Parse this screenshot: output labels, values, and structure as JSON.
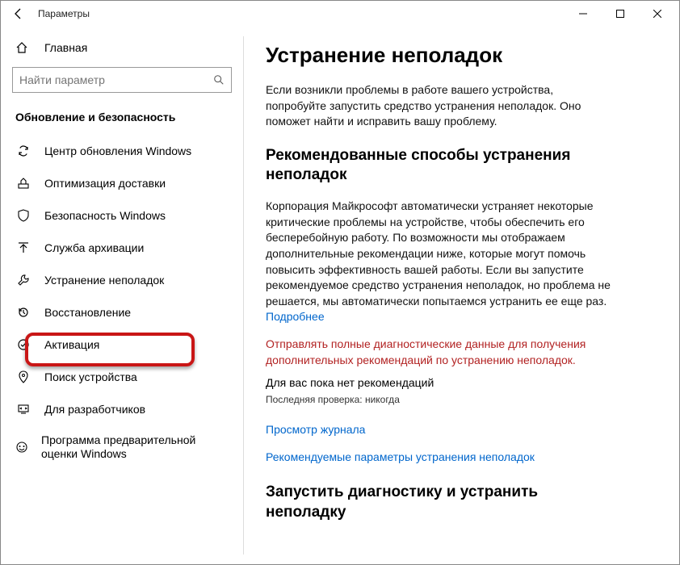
{
  "window": {
    "title": "Параметры"
  },
  "sidebar": {
    "home": "Главная",
    "search_placeholder": "Найти параметр",
    "section": "Обновление и безопасность",
    "items": [
      {
        "label": "Центр обновления Windows"
      },
      {
        "label": "Оптимизация доставки"
      },
      {
        "label": "Безопасность Windows"
      },
      {
        "label": "Служба архивации"
      },
      {
        "label": "Устранение неполадок"
      },
      {
        "label": "Восстановление"
      },
      {
        "label": "Активация"
      },
      {
        "label": "Поиск устройства"
      },
      {
        "label": "Для разработчиков"
      },
      {
        "label": "Программа предварительной оценки Windows"
      }
    ]
  },
  "main": {
    "h1": "Устранение неполадок",
    "intro": "Если возникли проблемы в работе вашего устройства, попробуйте запустить средство устранения неполадок. Оно поможет найти и исправить вашу проблему.",
    "h2a": "Рекомендованные способы устранения неполадок",
    "p2": "Корпорация Майкрософт автоматически устраняет некоторые критические проблемы на устройстве, чтобы обеспечить его бесперебойную работу. По возможности мы отображаем дополнительные рекомендации ниже, которые могут помочь повысить эффективность вашей работы. Если вы запустите рекомендуемое средство устранения неполадок, но проблема не решается, мы автоматически попытаемся устранить ее еще раз. ",
    "learn_more": "Подробнее",
    "red": "Отправлять полные диагностические данные для получения дополнительных рекомендаций по устранению неполадок.",
    "no_rec": "Для вас пока нет рекомендаций",
    "last_check": "Последняя проверка: никогда",
    "link1": "Просмотр журнала",
    "link2": "Рекомендуемые параметры устранения неполадок",
    "h2b": "Запустить диагностику и устранить неполадку"
  }
}
